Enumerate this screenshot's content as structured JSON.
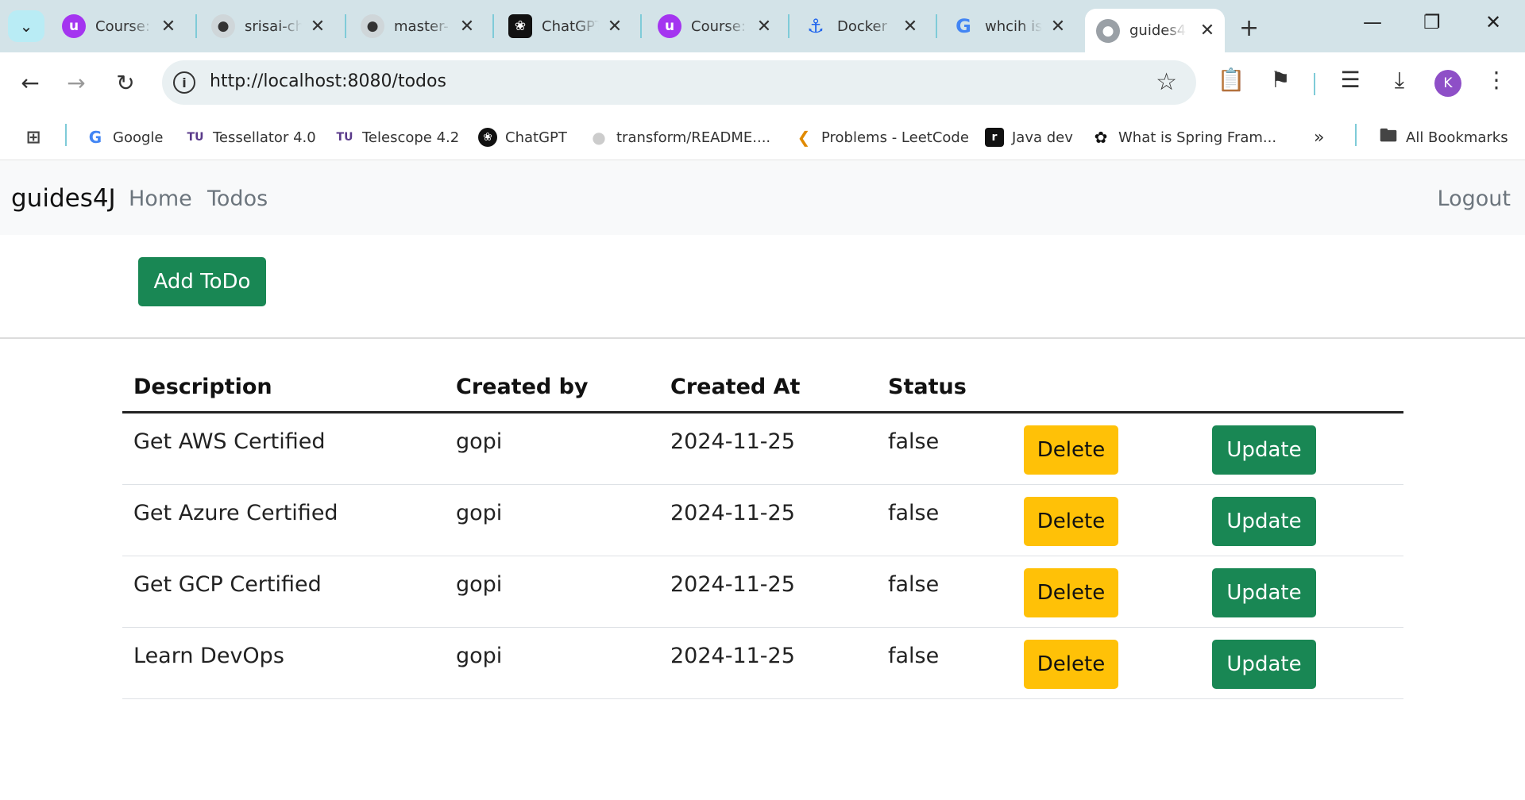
{
  "browser": {
    "tabs": [
      {
        "title": "Course:",
        "icon": "udemy-icon",
        "color": "#a435f0"
      },
      {
        "title": "srisai-ch",
        "icon": "github-icon",
        "color": "#333333"
      },
      {
        "title": "master-",
        "icon": "github-icon",
        "color": "#333333"
      },
      {
        "title": "ChatGPT",
        "icon": "chatgpt-icon",
        "color": "#000000"
      },
      {
        "title": "Course:",
        "icon": "udemy-icon",
        "color": "#a435f0"
      },
      {
        "title": "Docker",
        "icon": "docker-icon",
        "color": "#1d63ed"
      },
      {
        "title": "whcih is",
        "icon": "google-icon",
        "color": "#4285f4"
      },
      {
        "title": "guides4",
        "icon": "globe-icon",
        "color": "#666666",
        "active": true
      }
    ],
    "url": "http://localhost:8080/todos",
    "bookmarks": [
      {
        "label": "Google",
        "icon": "google-icon"
      },
      {
        "label": "Tessellator 4.0",
        "icon": "tu-icon"
      },
      {
        "label": "Telescope 4.2",
        "icon": "tu-icon"
      },
      {
        "label": "ChatGPT",
        "icon": "chatgpt-icon"
      },
      {
        "label": "transform/README....",
        "icon": "github-icon"
      },
      {
        "label": "Problems - LeetCode",
        "icon": "leetcode-icon"
      },
      {
        "label": "Java dev",
        "icon": "java-dev-icon"
      },
      {
        "label": "What is Spring Fram...",
        "icon": "spring-icon"
      }
    ],
    "all_bookmarks": "All Bookmarks",
    "profile_initial": "K"
  },
  "app": {
    "brand": "guides4J",
    "nav": {
      "home": "Home",
      "todos": "Todos",
      "logout": "Logout"
    },
    "add_button": "Add ToDo",
    "columns": [
      "Description",
      "Created by",
      "Created At",
      "Status"
    ],
    "todos": [
      {
        "description": "Get AWS Certified",
        "created_by": "gopi",
        "created_at": "2024-11-25",
        "status": "false"
      },
      {
        "description": "Get Azure Certified",
        "created_by": "gopi",
        "created_at": "2024-11-25",
        "status": "false"
      },
      {
        "description": "Get GCP Certified",
        "created_by": "gopi",
        "created_at": "2024-11-25",
        "status": "false"
      },
      {
        "description": "Learn DevOps",
        "created_by": "gopi",
        "created_at": "2024-11-25",
        "status": "false"
      }
    ],
    "delete_label": "Delete",
    "update_label": "Update",
    "colors": {
      "success": "#198754",
      "warning": "#ffc107",
      "navbar_bg": "#f8f9fa"
    }
  }
}
